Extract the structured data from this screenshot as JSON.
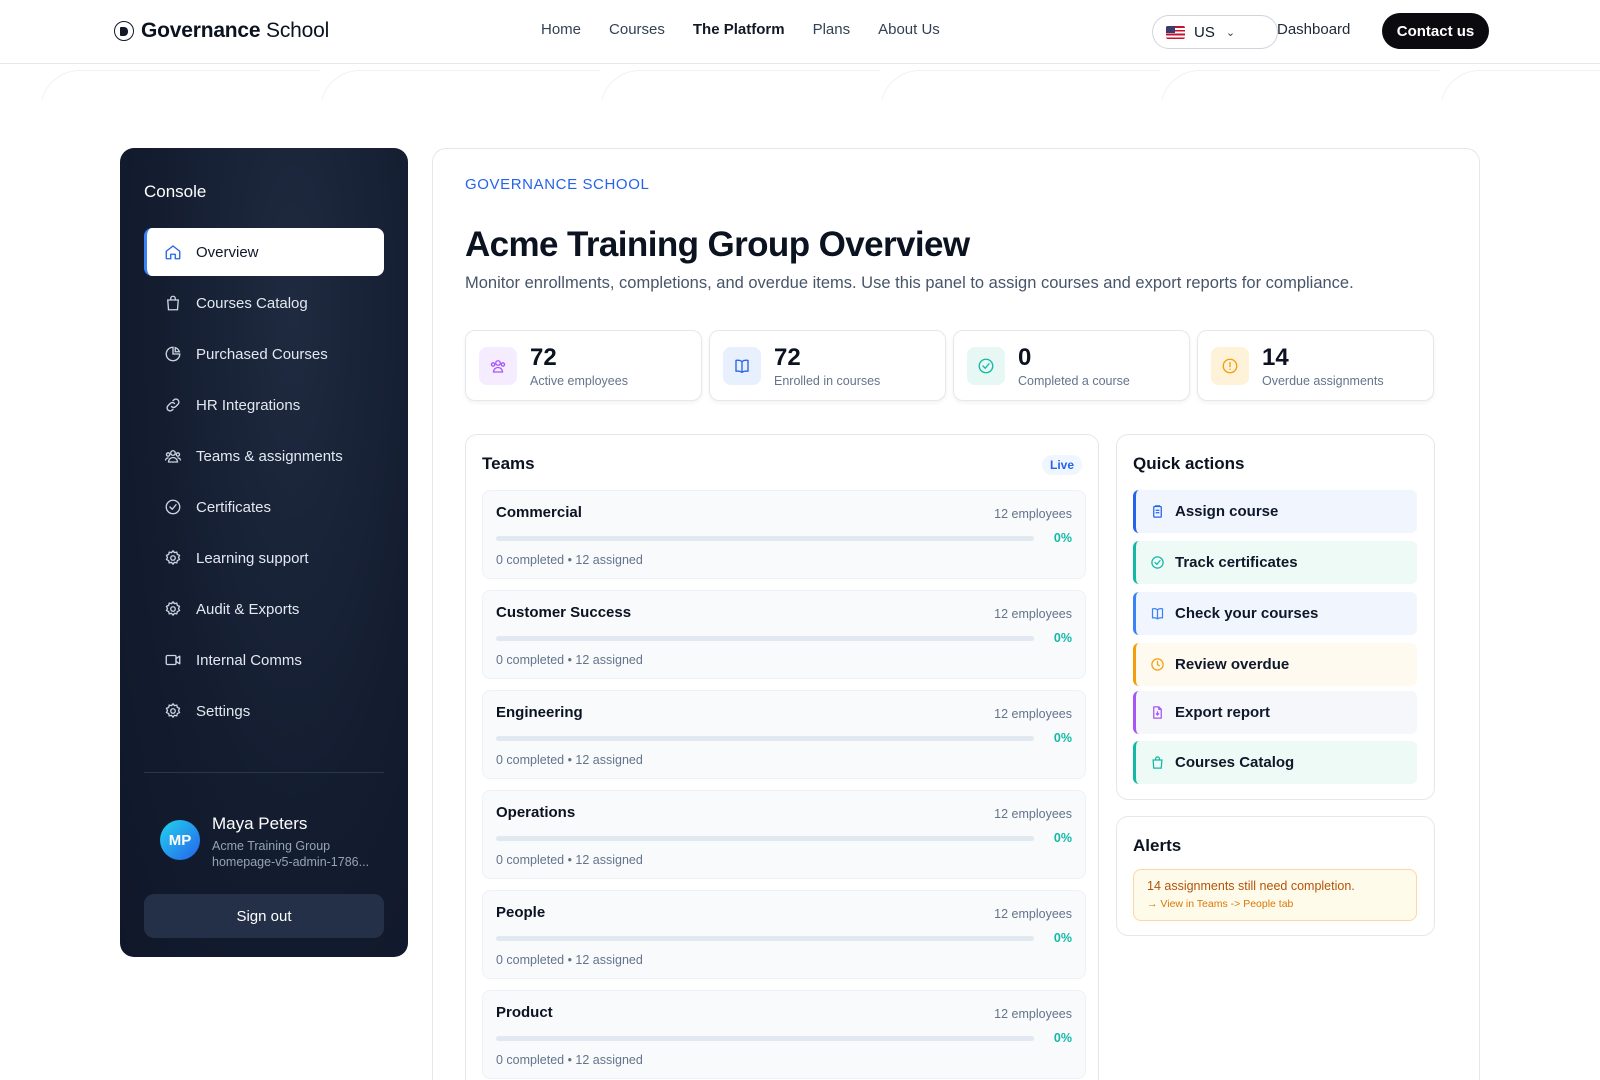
{
  "brand": {
    "name_bold": "Governance",
    "name_rest": " School"
  },
  "nav": {
    "links": [
      "Home",
      "Courses",
      "The Platform",
      "Plans",
      "About Us"
    ],
    "active_index": 2,
    "locale": "US",
    "dashboard": "Dashboard",
    "contact": "Contact us"
  },
  "sidebar": {
    "title": "Console",
    "items": [
      {
        "label": "Overview",
        "icon": "home-icon",
        "active": true
      },
      {
        "label": "Courses Catalog",
        "icon": "shopping-bag-icon"
      },
      {
        "label": "Purchased Courses",
        "icon": "pie-chart-icon"
      },
      {
        "label": "HR Integrations",
        "icon": "link-icon"
      },
      {
        "label": "Teams & assignments",
        "icon": "users-icon"
      },
      {
        "label": "Certificates",
        "icon": "check-circle-icon"
      },
      {
        "label": "Learning support",
        "icon": "gear-icon"
      },
      {
        "label": "Audit & Exports",
        "icon": "gear-icon"
      },
      {
        "label": "Internal Comms",
        "icon": "video-icon"
      },
      {
        "label": "Settings",
        "icon": "gear-icon"
      }
    ],
    "user": {
      "initials": "MP",
      "name": "Maya Peters",
      "org": "Acme Training Group",
      "id": "homepage-v5-admin-1786..."
    },
    "signout": "Sign out"
  },
  "main": {
    "eyebrow": "GOVERNANCE SCHOOL",
    "title": "Acme Training Group Overview",
    "subtitle": "Monitor enrollments, completions, and overdue items. Use this panel to assign courses and export reports for compliance.",
    "stats": [
      {
        "value": "72",
        "label": "Active employees",
        "icon": "users-icon",
        "color": "#a855f7",
        "bg": "#f5edff"
      },
      {
        "value": "72",
        "label": "Enrolled in courses",
        "icon": "book-open-icon",
        "color": "#2563eb",
        "bg": "#e8f0fe"
      },
      {
        "value": "0",
        "label": "Completed a course",
        "icon": "check-circle-icon",
        "color": "#14b8a6",
        "bg": "#e6f7f4"
      },
      {
        "value": "14",
        "label": "Overdue assignments",
        "icon": "alert-circle-icon",
        "color": "#f59e0b",
        "bg": "#fef3d8"
      }
    ],
    "teams": {
      "title": "Teams",
      "badge": "Live",
      "rows": [
        {
          "name": "Commercial",
          "count": "12 employees",
          "pct": "0%",
          "progress": 0,
          "meta": "0 completed • 12 assigned"
        },
        {
          "name": "Customer Success",
          "count": "12 employees",
          "pct": "0%",
          "progress": 0,
          "meta": "0 completed • 12 assigned"
        },
        {
          "name": "Engineering",
          "count": "12 employees",
          "pct": "0%",
          "progress": 0,
          "meta": "0 completed • 12 assigned"
        },
        {
          "name": "Operations",
          "count": "12 employees",
          "pct": "0%",
          "progress": 0,
          "meta": "0 completed • 12 assigned"
        },
        {
          "name": "People",
          "count": "12 employees",
          "pct": "0%",
          "progress": 0,
          "meta": "0 completed • 12 assigned"
        },
        {
          "name": "Product",
          "count": "12 employees",
          "pct": "0%",
          "progress": 0,
          "meta": "0 completed • 12 assigned"
        }
      ]
    },
    "quick_actions": {
      "title": "Quick actions",
      "items": [
        {
          "label": "Assign course",
          "icon": "clipboard-icon",
          "color": "#2563eb",
          "bg": "#f1f6fe"
        },
        {
          "label": "Track certificates",
          "icon": "check-circle-icon",
          "color": "#14b8a6",
          "bg": "#eefaf6"
        },
        {
          "label": "Check your courses",
          "icon": "book-open-icon",
          "color": "#3b82f6",
          "bg": "#f1f6fe"
        },
        {
          "label": "Review overdue",
          "icon": "clock-icon",
          "color": "#f59e0b",
          "bg": "#fffaf0"
        },
        {
          "label": "Export report",
          "icon": "file-icon",
          "color": "#a855f7",
          "bg": "#f5f7fb"
        },
        {
          "label": "Courses Catalog",
          "icon": "shopping-bag-icon",
          "color": "#14b8a6",
          "bg": "#eefaf6"
        }
      ]
    },
    "alerts": {
      "title": "Alerts",
      "message": "14 assignments still need completion.",
      "link": "→ View in Teams -> People tab"
    }
  }
}
